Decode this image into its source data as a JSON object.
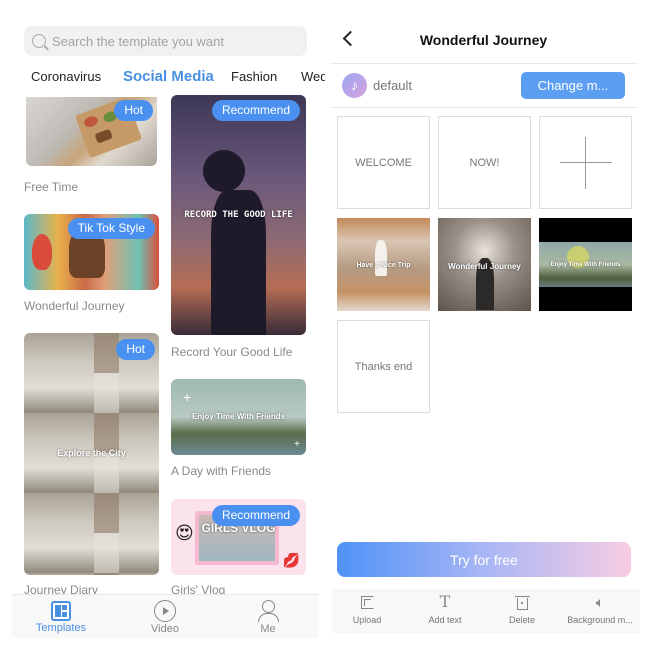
{
  "left": {
    "search": {
      "placeholder": "Search the template you want"
    },
    "categories": [
      {
        "label": "Coronavirus",
        "active": false
      },
      {
        "label": "Social Media",
        "active": true
      },
      {
        "label": "Fashion",
        "active": false
      },
      {
        "label": "Wedding",
        "active": false
      }
    ],
    "templates": [
      {
        "title": "Free Time",
        "badge": "Hot",
        "overlay": ""
      },
      {
        "title": "Wonderful Journey",
        "badge": "Tik Tok Style",
        "overlay": ""
      },
      {
        "title": "Journey Diary",
        "badge": "Hot",
        "overlay": "Explore the City"
      },
      {
        "title": "Record Your Good Life",
        "badge": "Recommend",
        "overlay": "RECORD THE GOOD LIFE"
      },
      {
        "title": "A Day with Friends",
        "badge": "",
        "overlay": "Enjoy Time With Friends"
      },
      {
        "title": "Girls' Vlog",
        "badge": "Recommend",
        "overlay": "GIRLS VLOG"
      }
    ],
    "bottom_nav": [
      {
        "label": "Templates",
        "icon": "templates-icon",
        "active": true
      },
      {
        "label": "Video",
        "icon": "play-circle-icon",
        "active": false
      },
      {
        "label": "Me",
        "icon": "user-icon",
        "active": false
      }
    ]
  },
  "right": {
    "title": "Wonderful Journey",
    "music": {
      "icon": "music-note-icon",
      "name": "default",
      "change_label": "Change m..."
    },
    "slots": [
      {
        "type": "text",
        "label": "WELCOME"
      },
      {
        "type": "text",
        "label": "NOW!"
      },
      {
        "type": "add",
        "label": ""
      },
      {
        "type": "image",
        "label": "Have a Nice Trip"
      },
      {
        "type": "image",
        "label": "Wonderful Journey"
      },
      {
        "type": "image",
        "label": "Enjoy Time With Friends"
      },
      {
        "type": "text",
        "label": "Thanks end"
      }
    ],
    "try_label": "Try for free",
    "toolbar": [
      {
        "label": "Upload",
        "icon": "upload-icon"
      },
      {
        "label": "Add text",
        "icon": "text-icon"
      },
      {
        "label": "Delete",
        "icon": "trash-icon"
      },
      {
        "label": "Background m...",
        "icon": "speaker-icon"
      }
    ]
  },
  "colors": {
    "accent": "#4a90e2",
    "badge": "#4a90f0",
    "button": "#5b9ef2"
  }
}
